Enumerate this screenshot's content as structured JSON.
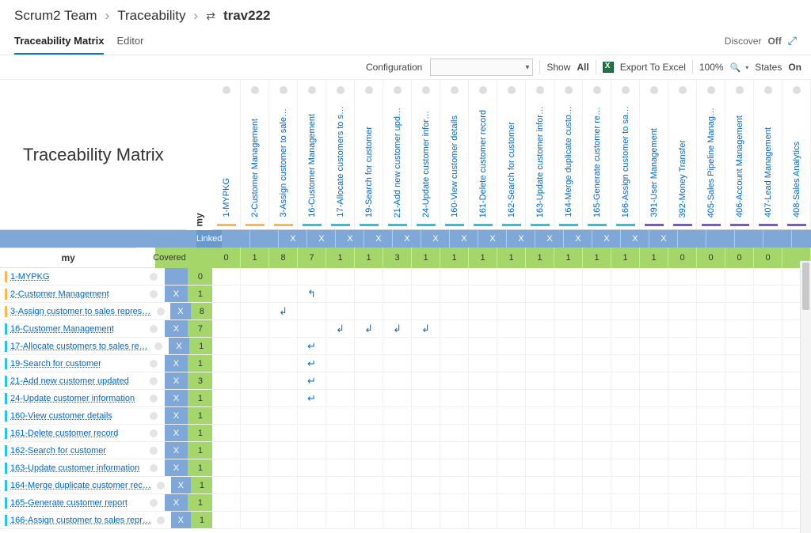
{
  "breadcrumb": {
    "team": "Scrum2 Team",
    "area": "Traceability",
    "item": "trav222"
  },
  "tabs": {
    "matrix": "Traceability Matrix",
    "editor": "Editor"
  },
  "discover": {
    "label": "Discover",
    "state": "Off"
  },
  "toolbar": {
    "config_label": "Configuration",
    "show": "Show",
    "all": "All",
    "export": "Export To Excel",
    "zoom": "100%",
    "states": "States",
    "on": "On"
  },
  "matrix_title": "Traceability Matrix",
  "labels": {
    "my": "my",
    "linked": "Linked",
    "covered": "Covered"
  },
  "columns": [
    {
      "id": "1-MYPKG",
      "color": "orange",
      "linked": "",
      "cov": "0"
    },
    {
      "id": "2-Customer Management",
      "color": "orange",
      "linked": "",
      "cov": "1"
    },
    {
      "id": "3-Assign customer to sale…",
      "color": "orange",
      "linked": "X",
      "cov": "8"
    },
    {
      "id": "16-Customer Management",
      "color": "teal",
      "linked": "X",
      "cov": "7"
    },
    {
      "id": "17-Allocate customers to s…",
      "color": "teal",
      "linked": "X",
      "cov": "1"
    },
    {
      "id": "19-Search for customer",
      "color": "teal",
      "linked": "X",
      "cov": "1"
    },
    {
      "id": "21-Add new customer upd…",
      "color": "teal",
      "linked": "X",
      "cov": "3"
    },
    {
      "id": "24-Update customer infor…",
      "color": "teal",
      "linked": "X",
      "cov": "1"
    },
    {
      "id": "160-View customer details",
      "color": "teal",
      "linked": "X",
      "cov": "1"
    },
    {
      "id": "161-Delete customer record",
      "color": "teal",
      "linked": "X",
      "cov": "1"
    },
    {
      "id": "162-Search for customer",
      "color": "teal",
      "linked": "X",
      "cov": "1"
    },
    {
      "id": "163-Update customer infor…",
      "color": "teal",
      "linked": "X",
      "cov": "1"
    },
    {
      "id": "164-Merge duplicate custo…",
      "color": "teal",
      "linked": "X",
      "cov": "1"
    },
    {
      "id": "165-Generate customer re…",
      "color": "teal",
      "linked": "X",
      "cov": "1"
    },
    {
      "id": "166-Assign customer to sa…",
      "color": "teal",
      "linked": "X",
      "cov": "1"
    },
    {
      "id": "391-User Management",
      "color": "purple",
      "linked": "X",
      "cov": "1"
    },
    {
      "id": "392-Money Transfer",
      "color": "purple",
      "linked": "",
      "cov": "0"
    },
    {
      "id": "405-Sales Pipeline Manag…",
      "color": "purple",
      "linked": "",
      "cov": "0"
    },
    {
      "id": "406-Account Management",
      "color": "purple",
      "linked": "",
      "cov": "0"
    },
    {
      "id": "407-Lead Management",
      "color": "purple",
      "linked": "",
      "cov": "0"
    },
    {
      "id": "408-Sales Analytics",
      "color": "purple",
      "linked": "",
      "cov": ""
    }
  ],
  "rows": [
    {
      "id": "1-MYPKG",
      "color": "orange",
      "linked": "",
      "cov": "0",
      "cells": {}
    },
    {
      "id": "2-Customer Management",
      "color": "orange",
      "linked": "X",
      "cov": "1",
      "cells": {
        "3": "↰"
      }
    },
    {
      "id": "3-Assign customer to sales repres…",
      "color": "orange",
      "linked": "X",
      "cov": "8",
      "cells": {
        "2": "↲"
      }
    },
    {
      "id": "16-Customer Management",
      "color": "teal",
      "linked": "X",
      "cov": "7",
      "cells": {
        "4": "↲",
        "5": "↲",
        "6": "↲",
        "7": "↲"
      }
    },
    {
      "id": "17-Allocate customers to sales re…",
      "color": "teal",
      "linked": "X",
      "cov": "1",
      "cells": {
        "3": "↵"
      }
    },
    {
      "id": "19-Search for customer",
      "color": "teal",
      "linked": "X",
      "cov": "1",
      "cells": {
        "3": "↵"
      }
    },
    {
      "id": "21-Add new customer updated",
      "color": "teal",
      "linked": "X",
      "cov": "3",
      "cells": {
        "3": "↵"
      }
    },
    {
      "id": "24-Update customer information",
      "color": "teal",
      "linked": "X",
      "cov": "1",
      "cells": {
        "3": "↵"
      }
    },
    {
      "id": "160-View customer details",
      "color": "teal",
      "linked": "X",
      "cov": "1",
      "cells": {}
    },
    {
      "id": "161-Delete customer record",
      "color": "teal",
      "linked": "X",
      "cov": "1",
      "cells": {}
    },
    {
      "id": "162-Search for customer",
      "color": "teal",
      "linked": "X",
      "cov": "1",
      "cells": {}
    },
    {
      "id": "163-Update customer information",
      "color": "teal",
      "linked": "X",
      "cov": "1",
      "cells": {}
    },
    {
      "id": "164-Merge duplicate customer rec…",
      "color": "teal",
      "linked": "X",
      "cov": "1",
      "cells": {}
    },
    {
      "id": "165-Generate customer report",
      "color": "teal",
      "linked": "X",
      "cov": "1",
      "cells": {}
    },
    {
      "id": "166-Assign customer to sales repr…",
      "color": "teal",
      "linked": "X",
      "cov": "1",
      "cells": {}
    }
  ]
}
